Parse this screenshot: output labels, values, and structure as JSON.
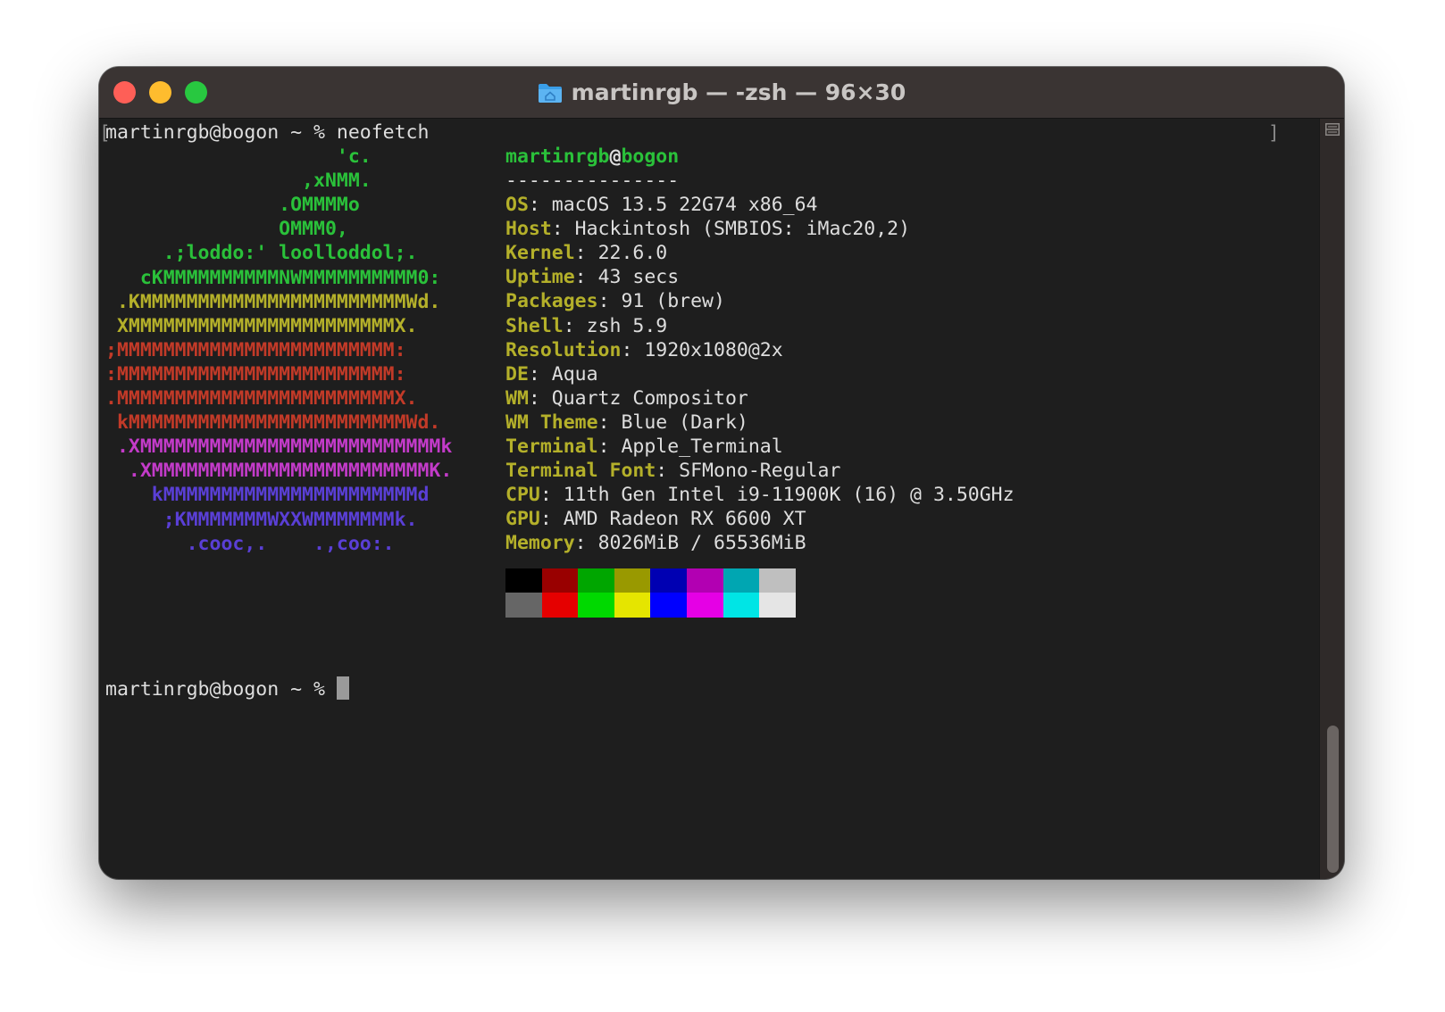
{
  "window": {
    "title": "martinrgb — -zsh — 96×30"
  },
  "terminal": {
    "command_prompt": "martinrgb@bogon ~ % neofetch",
    "prompt_open_bracket": "[",
    "prompt_close_bracket": "]",
    "final_prompt": "martinrgb@bogon ~ % ",
    "user": "martinrgb",
    "at": "@",
    "host": "bogon",
    "separator": "---------------",
    "logo": [
      {
        "text": "                    'c.",
        "color": "#2ac13a"
      },
      {
        "text": "                 ,xNMM.",
        "color": "#2ac13a"
      },
      {
        "text": "               .OMMMMo",
        "color": "#2ac13a"
      },
      {
        "text": "               OMMM0,",
        "color": "#2ac13a"
      },
      {
        "text": "     .;loddo:' loolloddol;.",
        "color": "#2ac13a"
      },
      {
        "text": "   cKMMMMMMMMMMNWMMMMMMMMMM0:",
        "color": "#2ac13a"
      },
      {
        "text": " .KMMMMMMMMMMMMMMMMMMMMMMMWd.",
        "color": "#b4b02a"
      },
      {
        "text": " XMMMMMMMMMMMMMMMMMMMMMMMX.",
        "color": "#b4b02a"
      },
      {
        "text": ";MMMMMMMMMMMMMMMMMMMMMMMM:",
        "color": "#c23a28"
      },
      {
        "text": ":MMMMMMMMMMMMMMMMMMMMMMMM:",
        "color": "#c23a28"
      },
      {
        "text": ".MMMMMMMMMMMMMMMMMMMMMMMMX.",
        "color": "#c23a28"
      },
      {
        "text": " kMMMMMMMMMMMMMMMMMMMMMMMMWd.",
        "color": "#c23a28"
      },
      {
        "text": " .XMMMMMMMMMMMMMMMMMMMMMMMMMMk",
        "color": "#c33bc9"
      },
      {
        "text": "  .XMMMMMMMMMMMMMMMMMMMMMMMMK.",
        "color": "#c33bc9"
      },
      {
        "text": "    kMMMMMMMMMMMMMMMMMMMMMMd",
        "color": "#5a3fd6"
      },
      {
        "text": "     ;KMMMMMMMWXXWMMMMMMMk.",
        "color": "#5a3fd6"
      },
      {
        "text": "       .cooc,.    .,coo:.",
        "color": "#5a3fd6"
      }
    ],
    "info": [
      {
        "key": "OS",
        "value": "macOS 13.5 22G74 x86_64"
      },
      {
        "key": "Host",
        "value": "Hackintosh (SMBIOS: iMac20,2)"
      },
      {
        "key": "Kernel",
        "value": "22.6.0"
      },
      {
        "key": "Uptime",
        "value": "43 secs"
      },
      {
        "key": "Packages",
        "value": "91 (brew)"
      },
      {
        "key": "Shell",
        "value": "zsh 5.9"
      },
      {
        "key": "Resolution",
        "value": "1920x1080@2x"
      },
      {
        "key": "DE",
        "value": "Aqua"
      },
      {
        "key": "WM",
        "value": "Quartz Compositor"
      },
      {
        "key": "WM Theme",
        "value": "Blue (Dark)"
      },
      {
        "key": "Terminal",
        "value": "Apple_Terminal"
      },
      {
        "key": "Terminal Font",
        "value": "SFMono-Regular"
      },
      {
        "key": "CPU",
        "value": "11th Gen Intel i9-11900K (16) @ 3.50GHz"
      },
      {
        "key": "GPU",
        "value": "AMD Radeon RX 6600 XT"
      },
      {
        "key": "Memory",
        "value": "8026MiB / 65536MiB"
      }
    ],
    "palette_row1": [
      "#000000",
      "#990000",
      "#00a600",
      "#999900",
      "#0000b2",
      "#b200b2",
      "#00a6b2",
      "#bfbfbf"
    ],
    "palette_row2": [
      "#666666",
      "#e50000",
      "#00d900",
      "#e5e500",
      "#0000ff",
      "#e500e5",
      "#00e5e5",
      "#e5e5e5"
    ]
  },
  "colors": {
    "background": "#1e1e1e",
    "titlebar": "#3a3433",
    "text": "#dedede",
    "info_key": "#b4b02a",
    "user_host": "#2ac13a"
  },
  "icons": {
    "title": "home-folder-icon",
    "split": "split-pane-icon"
  }
}
